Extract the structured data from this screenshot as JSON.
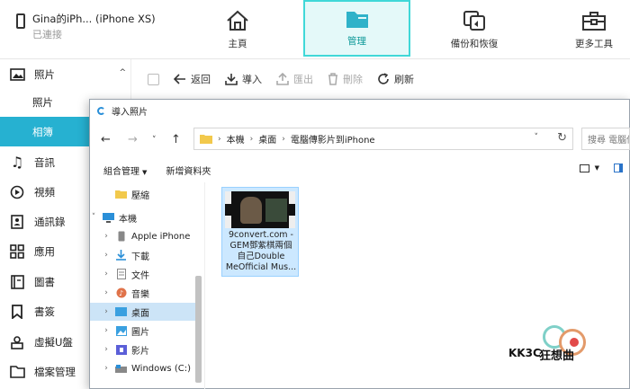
{
  "device": {
    "name": "Gina的iPh... (iPhone XS)",
    "status": "已連接"
  },
  "topnav": [
    {
      "label": "主頁",
      "icon": "home-icon"
    },
    {
      "label": "管理",
      "icon": "folder-icon",
      "active": true
    },
    {
      "label": "備份和恢復",
      "icon": "sync-icon"
    },
    {
      "label": "更多工具",
      "icon": "toolbox-icon"
    }
  ],
  "sidebar": {
    "items": [
      {
        "label": "照片",
        "icon": "photo-icon"
      },
      {
        "label": "照片"
      },
      {
        "label": "相簿",
        "active": true
      },
      {
        "label": "音訊",
        "icon": "music-icon"
      },
      {
        "label": "視頻",
        "icon": "video-icon"
      },
      {
        "label": "通訊錄",
        "icon": "contacts-icon"
      },
      {
        "label": "應用",
        "icon": "apps-icon"
      },
      {
        "label": "圖書",
        "icon": "book-icon"
      },
      {
        "label": "書簽",
        "icon": "bookmark-icon"
      },
      {
        "label": "虛擬U盤",
        "icon": "usb-icon"
      },
      {
        "label": "檔案管理",
        "icon": "file-manager-icon"
      }
    ]
  },
  "toolbar": {
    "back": "返回",
    "import": "導入",
    "export": "匯出",
    "delete": "刪除",
    "refresh": "刷新"
  },
  "dialog": {
    "title": "導入照片",
    "breadcrumb": [
      "本機",
      "桌面",
      "電腦傳影片到iPhone"
    ],
    "search_placeholder": "搜尋 電腦傳影片到iPhone",
    "organize": "組合管理",
    "new_folder": "新增資料夾",
    "tree": [
      {
        "label": "壓縮"
      },
      {
        "label": "本機"
      },
      {
        "label": "Apple iPhone"
      },
      {
        "label": "下載"
      },
      {
        "label": "文件"
      },
      {
        "label": "音樂"
      },
      {
        "label": "桌面",
        "selected": true
      },
      {
        "label": "圖片"
      },
      {
        "label": "影片"
      },
      {
        "label": "Windows (C:)"
      }
    ],
    "file": {
      "name_lines": [
        "9convert.com -",
        "GEM鄧紫棋兩個",
        "自己Double",
        "MeOfficial Mus..."
      ]
    }
  },
  "watermark": {
    "left": "KK3C",
    "right": "狂想曲"
  }
}
